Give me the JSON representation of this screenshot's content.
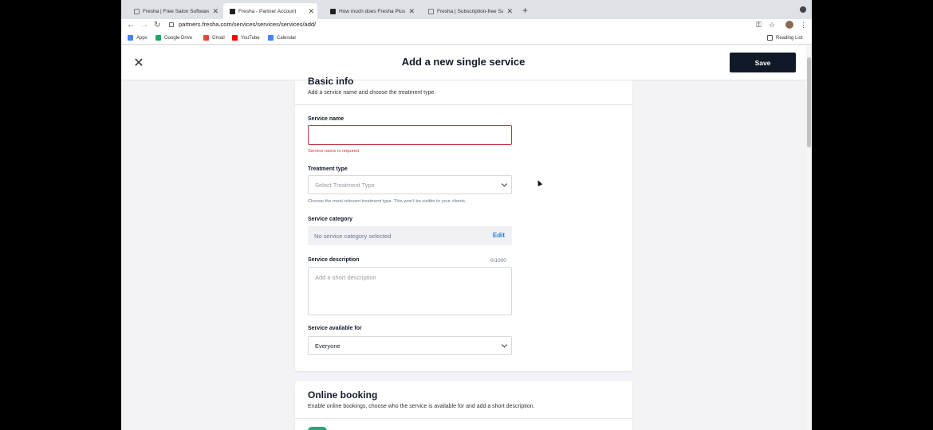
{
  "browser": {
    "tabs": [
      {
        "title": "Fresha | Free Salon Software |",
        "active": false
      },
      {
        "title": "Fresha - Partner Account",
        "active": true
      },
      {
        "title": "How much does Fresha Plus co",
        "active": false
      },
      {
        "title": "Fresha | Subscription-free Salo",
        "active": false
      }
    ],
    "new_tab": "+",
    "url": "partners.fresha.com/services/services/services/add/",
    "bookmarks": [
      {
        "label": "Apps",
        "icon": "apps-grid-icon",
        "color": "#4285f4"
      },
      {
        "label": "Google Drive",
        "icon": "google-drive-icon",
        "color": "#1fa463"
      },
      {
        "label": "Gmail",
        "icon": "gmail-icon",
        "color": "#ea4335"
      },
      {
        "label": "YouTube",
        "icon": "youtube-icon",
        "color": "#ff0000"
      },
      {
        "label": "Calendar",
        "icon": "calendar-icon",
        "color": "#4285f4"
      }
    ],
    "reading_list": "Reading List"
  },
  "header": {
    "title": "Add a new single service",
    "save_label": "Save",
    "close_glyph": "✕"
  },
  "basic_info": {
    "title": "Basic info",
    "subtitle": "Add a service name and choose the treatment type.",
    "service_name_label": "Service name",
    "service_name_value": "",
    "service_name_error": "Service name is required",
    "treatment_type_label": "Treatment type",
    "treatment_type_placeholder": "Select Treatment Type",
    "treatment_type_hint": "Choose the most relevant treatment type. This won't be visible to your clients.",
    "category_label": "Service category",
    "category_value": "No service category selected",
    "category_edit": "Edit",
    "description_label": "Service description",
    "description_counter": "0/1000",
    "description_placeholder": "Add a short description",
    "available_label": "Service available for",
    "available_value": "Everyone"
  },
  "online_booking": {
    "title": "Online booking",
    "subtitle": "Enable online bookings, choose who the service is available for and add a short description.",
    "enabled": true
  },
  "colors": {
    "primary": "#101928",
    "error": "#c73645",
    "link": "#2883d3",
    "toggle_on": "#2aa378"
  }
}
